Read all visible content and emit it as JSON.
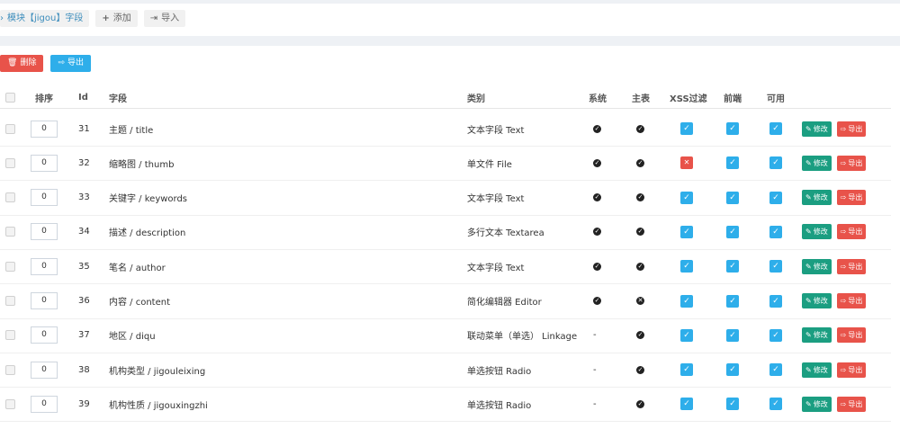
{
  "tabs": [
    {
      "label": "模块【jigou】字段",
      "icon": "chevron-right-icon"
    },
    {
      "label": "添加",
      "icon": "plus-icon"
    },
    {
      "label": "导入",
      "icon": "import-icon"
    }
  ],
  "toolbar": {
    "delete_label": "删除",
    "export_label": "导出"
  },
  "headers": {
    "sort": "排序",
    "id": "Id",
    "field": "字段",
    "type": "类别",
    "system": "系统",
    "main": "主表",
    "xss": "XSS过滤",
    "front": "前端",
    "enabled": "可用"
  },
  "actions": {
    "edit": "修改",
    "export": "导出"
  },
  "colors": {
    "accent": "#2eaeea",
    "danger": "#e8534a",
    "edit": "#1b9e81"
  },
  "rows": [
    {
      "order": "0",
      "id": "31",
      "field": "主题 / title",
      "type": "文本字段 Text",
      "system": "check",
      "main": "check",
      "xss": true,
      "front": true,
      "enabled": true
    },
    {
      "order": "0",
      "id": "32",
      "field": "缩略图 / thumb",
      "type": "单文件 File",
      "system": "check",
      "main": "check",
      "xss": false,
      "front": true,
      "enabled": true
    },
    {
      "order": "0",
      "id": "33",
      "field": "关键字 / keywords",
      "type": "文本字段 Text",
      "system": "check",
      "main": "check",
      "xss": true,
      "front": true,
      "enabled": true
    },
    {
      "order": "0",
      "id": "34",
      "field": "描述 / description",
      "type": "多行文本 Textarea",
      "system": "check",
      "main": "check",
      "xss": true,
      "front": true,
      "enabled": true
    },
    {
      "order": "0",
      "id": "35",
      "field": "笔名 / author",
      "type": "文本字段 Text",
      "system": "check",
      "main": "check",
      "xss": true,
      "front": true,
      "enabled": true
    },
    {
      "order": "0",
      "id": "36",
      "field": "内容 / content",
      "type": "简化编辑器 Editor",
      "system": "check",
      "main": "x",
      "xss": true,
      "front": true,
      "enabled": true
    },
    {
      "order": "0",
      "id": "37",
      "field": "地区 / diqu",
      "type": "联动菜单（单选） Linkage",
      "system": "-",
      "main": "check",
      "xss": true,
      "front": true,
      "enabled": true
    },
    {
      "order": "0",
      "id": "38",
      "field": "机构类型 / jigouleixing",
      "type": "单选按钮 Radio",
      "system": "-",
      "main": "check",
      "xss": true,
      "front": true,
      "enabled": true
    },
    {
      "order": "0",
      "id": "39",
      "field": "机构性质 / jigouxingzhi",
      "type": "单选按钮 Radio",
      "system": "-",
      "main": "check",
      "xss": true,
      "front": true,
      "enabled": true
    }
  ]
}
